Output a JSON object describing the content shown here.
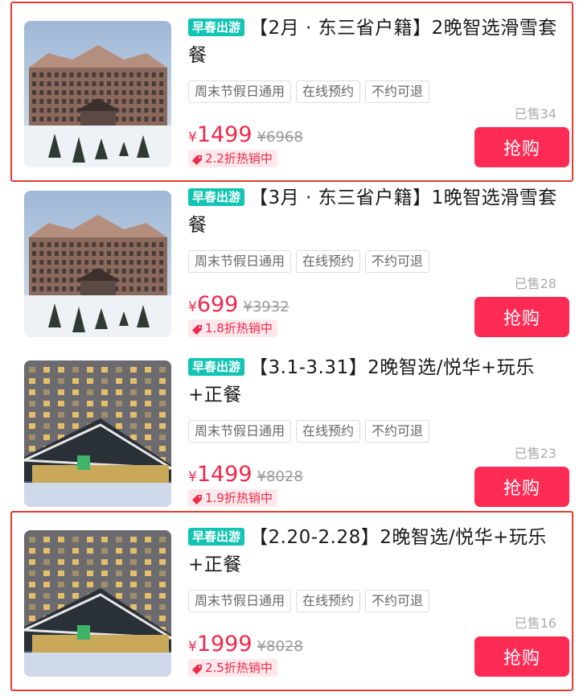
{
  "cards": [
    {
      "highlighted": true,
      "promo": "早春出游",
      "title": "【2月 · 东三省户籍】2晚智选滑雪套餐",
      "tags": [
        "周末节假日通用",
        "在线预约",
        "不约可退"
      ],
      "sold": "已售34",
      "currency": "¥",
      "price": "1499",
      "original": "¥6968",
      "discount": "2.2折热销中",
      "buy": "抢购",
      "image": "snow-resort"
    },
    {
      "highlighted": false,
      "promo": "早春出游",
      "title": "【3月 · 东三省户籍】1晚智选滑雪套餐",
      "tags": [
        "周末节假日通用",
        "在线预约",
        "不约可退"
      ],
      "sold": "已售28",
      "currency": "¥",
      "price": "699",
      "original": "¥3932",
      "discount": "1.8折热销中",
      "buy": "抢购",
      "image": "snow-resort"
    },
    {
      "highlighted": false,
      "promo": "早春出游",
      "title": "【3.1-3.31】2晚智选/悦华+玩乐+正餐",
      "tags": [
        "周末节假日通用",
        "在线预约",
        "不约可退"
      ],
      "sold": "已售23",
      "currency": "¥",
      "price": "1499",
      "original": "¥8028",
      "discount": "1.9折热销中",
      "buy": "抢购",
      "image": "hotel-night"
    },
    {
      "highlighted": true,
      "promo": "早春出游",
      "title": "【2.20-2.28】2晚智选/悦华+玩乐+正餐",
      "tags": [
        "周末节假日通用",
        "在线预约",
        "不约可退"
      ],
      "sold": "已售16",
      "currency": "¥",
      "price": "1999",
      "original": "¥8028",
      "discount": "2.5折热销中",
      "buy": "抢购",
      "image": "hotel-night"
    }
  ],
  "colors": {
    "promo": "#12c4b3",
    "price": "#f0294b",
    "buy": "#fe2c55",
    "highlight_border": "#e13c32"
  }
}
